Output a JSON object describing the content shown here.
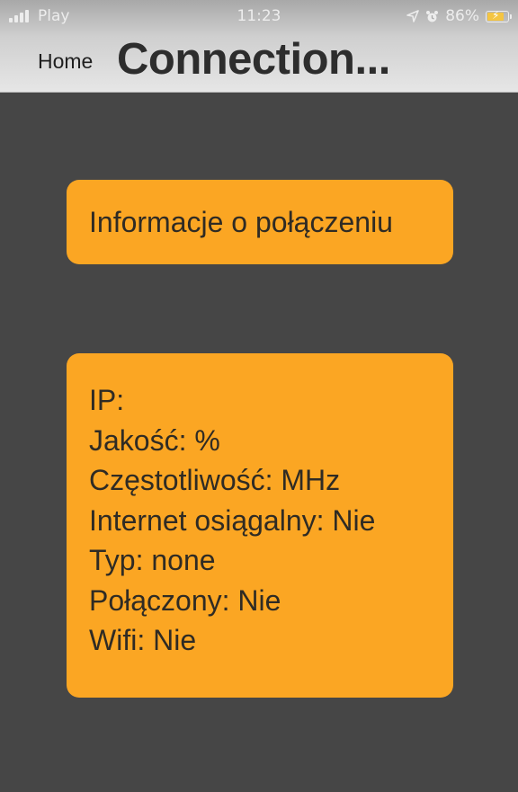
{
  "status_bar": {
    "carrier": "Play",
    "time": "11:23",
    "battery_percent": "86%",
    "battery_level": 0.86,
    "icons": [
      "signal-icon",
      "location-arrow-icon",
      "alarm-clock-icon",
      "battery-charging-icon"
    ]
  },
  "nav": {
    "back_label": "Home",
    "title": "Connection..."
  },
  "header_card": {
    "title": "Informacje o połączeniu"
  },
  "info_card": {
    "rows": [
      "IP:",
      "Jakość: %",
      "Częstotliwość: MHz",
      "Internet osiągalny: Nie",
      "Typ: none",
      "Połączony: Nie",
      "Wifi: Nie"
    ]
  },
  "colors": {
    "background": "#464646",
    "card": "#fba623",
    "header": "#d8d8d8"
  }
}
